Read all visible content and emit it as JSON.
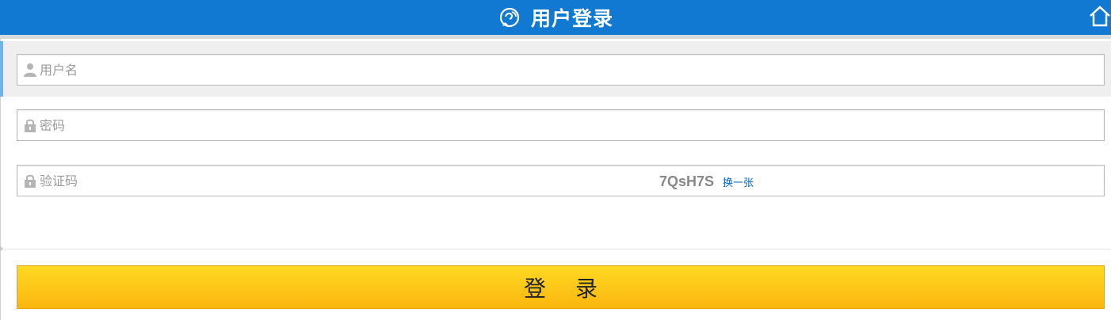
{
  "header": {
    "title": "用户登录",
    "logo_icon": "chat-logo-icon",
    "home_icon": "home-icon",
    "background_color": "#1179d2"
  },
  "form": {
    "username": {
      "placeholder": "用户名",
      "value": "",
      "icon": "user-icon"
    },
    "password": {
      "placeholder": "密码",
      "value": "",
      "icon": "lock-icon"
    },
    "captcha": {
      "placeholder": "验证码",
      "value": "",
      "icon": "lock-icon",
      "code": "7QsH7S",
      "refresh_label": "换一张"
    }
  },
  "login_button": {
    "label": "登 录",
    "color": "#fbb60f"
  }
}
